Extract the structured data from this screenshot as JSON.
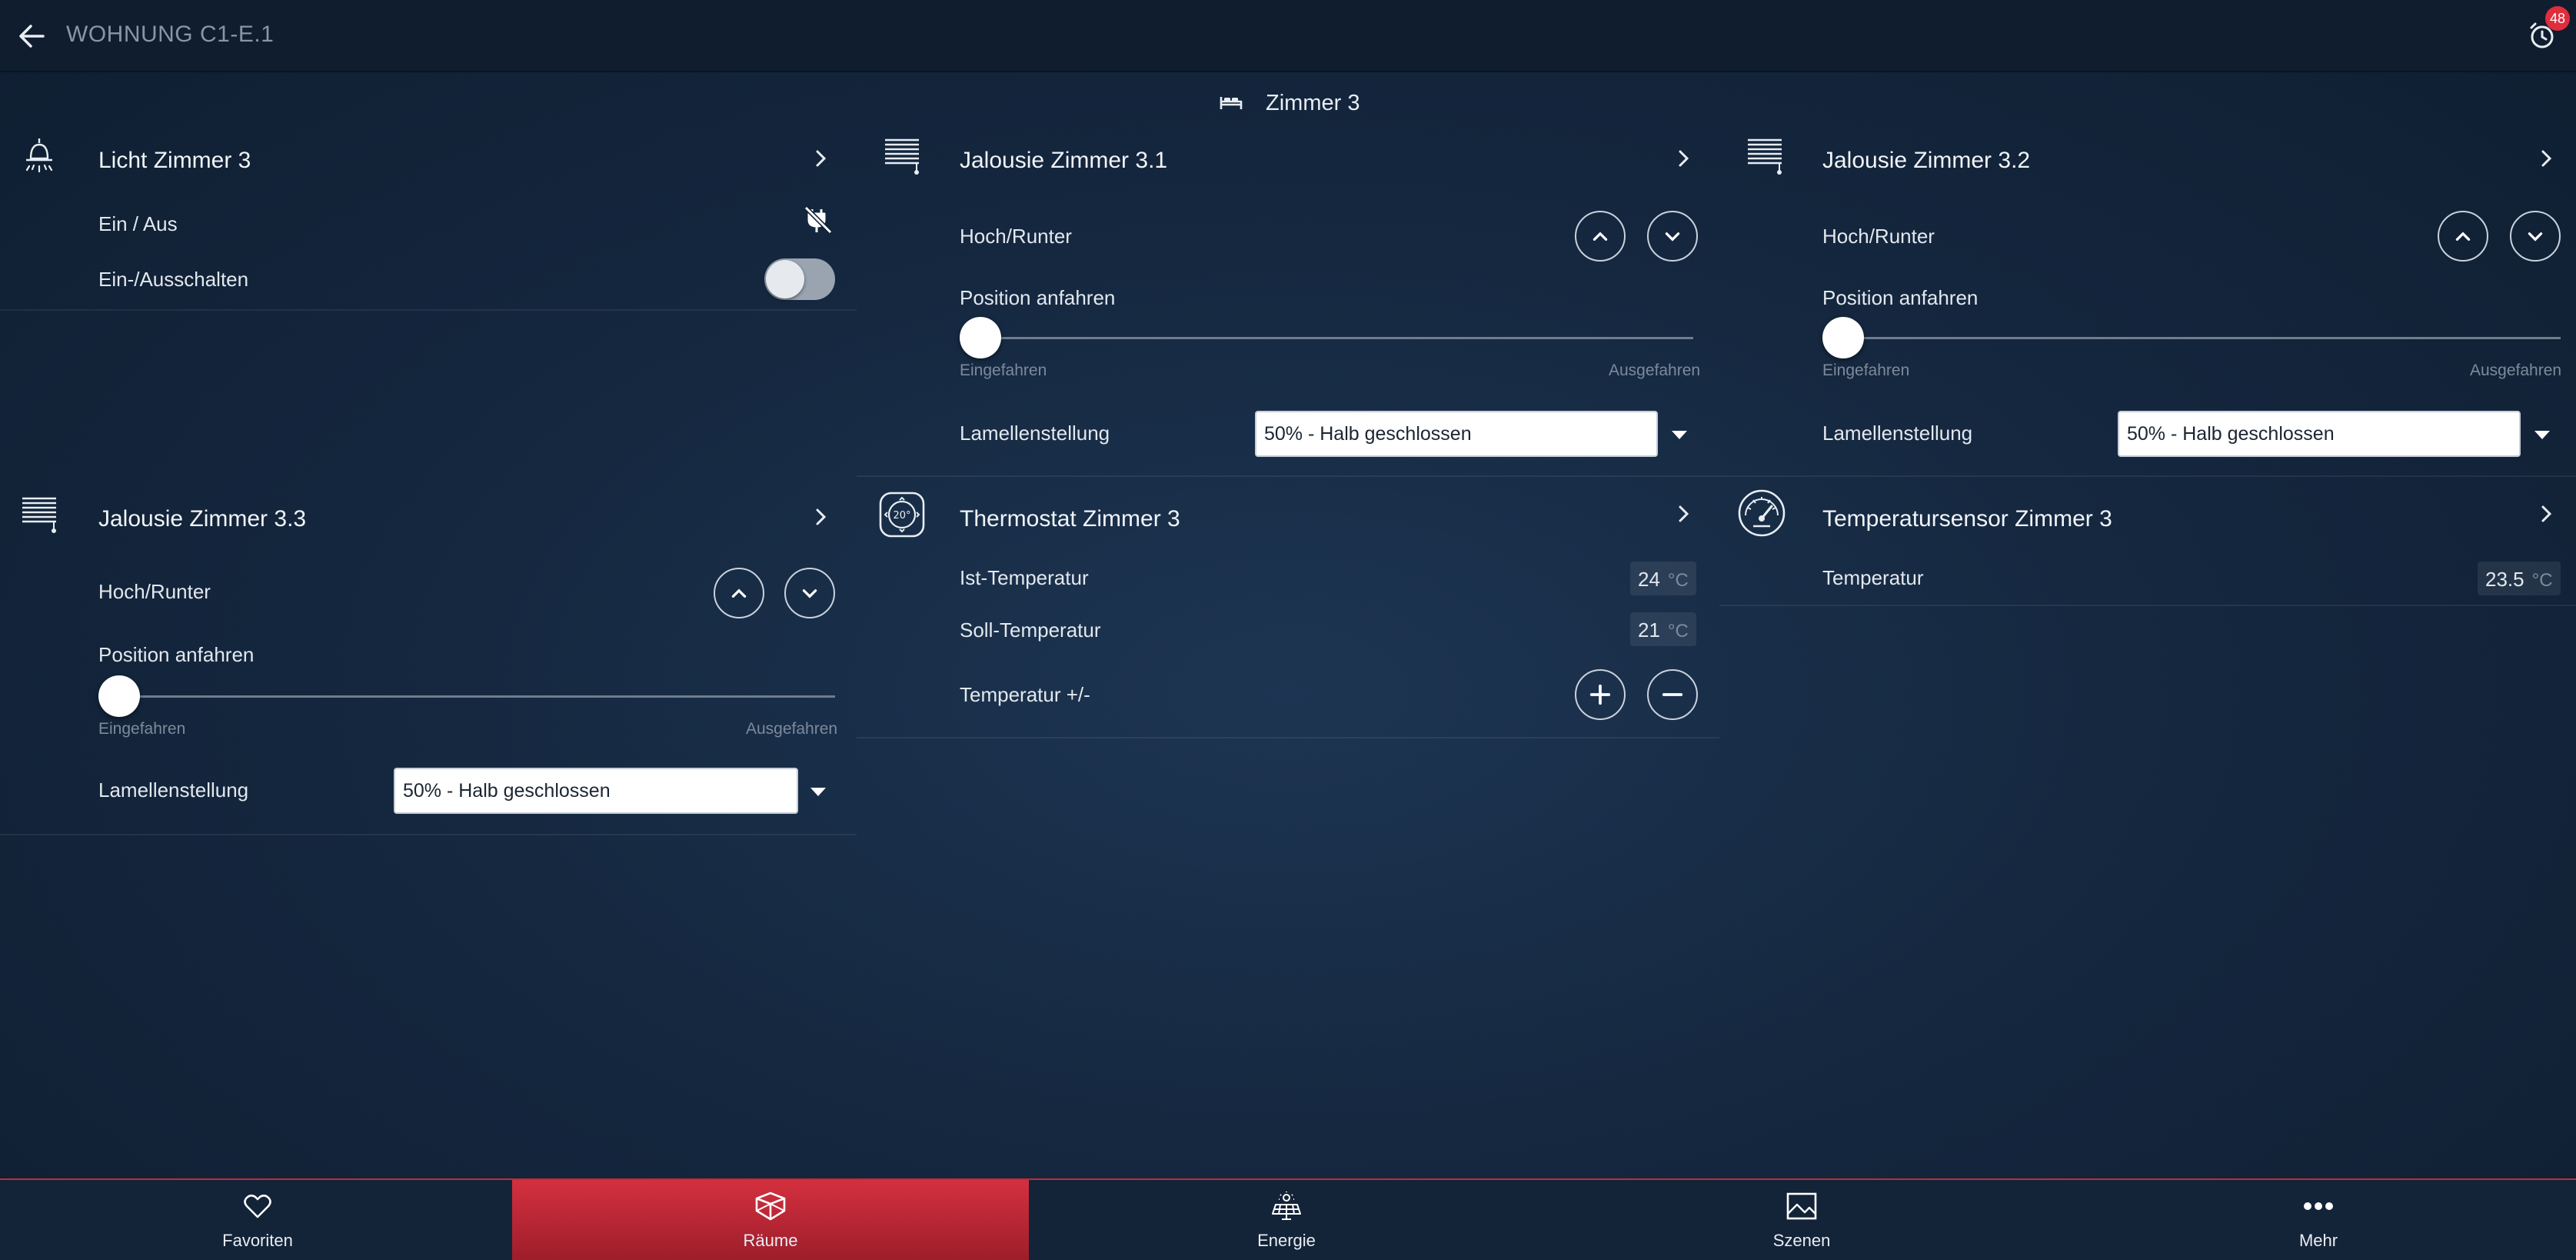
{
  "header": {
    "title": "WOHNUNG C1-E.1",
    "alarm_badge": "48"
  },
  "room": {
    "name": "Zimmer 3"
  },
  "cards": {
    "licht": {
      "title": "Licht Zimmer 3",
      "onoff_label": "Ein / Aus",
      "switch_label": "Ein-/Ausschalten",
      "switch_on": false
    },
    "jal31": {
      "title": "Jalousie Zimmer 3.1",
      "updown_label": "Hoch/Runter",
      "position_label": "Position anfahren",
      "min_label": "Eingefahren",
      "max_label": "Ausgefahren",
      "position_percent": 0,
      "lamellen_label": "Lamellenstellung",
      "lamellen_value": "50% - Halb geschlossen"
    },
    "jal32": {
      "title": "Jalousie Zimmer 3.2",
      "updown_label": "Hoch/Runter",
      "position_label": "Position anfahren",
      "min_label": "Eingefahren",
      "max_label": "Ausgefahren",
      "position_percent": 0,
      "lamellen_label": "Lamellenstellung",
      "lamellen_value": "50% - Halb geschlossen"
    },
    "jal33": {
      "title": "Jalousie Zimmer 3.3",
      "updown_label": "Hoch/Runter",
      "position_label": "Position anfahren",
      "min_label": "Eingefahren",
      "max_label": "Ausgefahren",
      "position_percent": 0,
      "lamellen_label": "Lamellenstellung",
      "lamellen_value": "50% - Halb geschlossen"
    },
    "thermo": {
      "title": "Thermostat Zimmer 3",
      "icon_text": "20°",
      "ist_label": "Ist-Temperatur",
      "ist_value": "24",
      "soll_label": "Soll-Temperatur",
      "soll_value": "21",
      "plusminus_label": "Temperatur +/-",
      "unit": "°C"
    },
    "sensor": {
      "title": "Temperatursensor Zimmer 3",
      "temp_label": "Temperatur",
      "temp_value": "23.5",
      "unit": "°C"
    }
  },
  "nav": {
    "items": [
      {
        "label": "Favoriten",
        "icon": "heart-icon"
      },
      {
        "label": "Räume",
        "icon": "cube-icon"
      },
      {
        "label": "Energie",
        "icon": "solar-panel-icon"
      },
      {
        "label": "Szenen",
        "icon": "image-icon"
      },
      {
        "label": "Mehr",
        "icon": "more-icon"
      }
    ],
    "active": "Räume"
  },
  "colors": {
    "accent": "#d4303f",
    "background": "#152840",
    "topbar": "#0f1d2e"
  }
}
